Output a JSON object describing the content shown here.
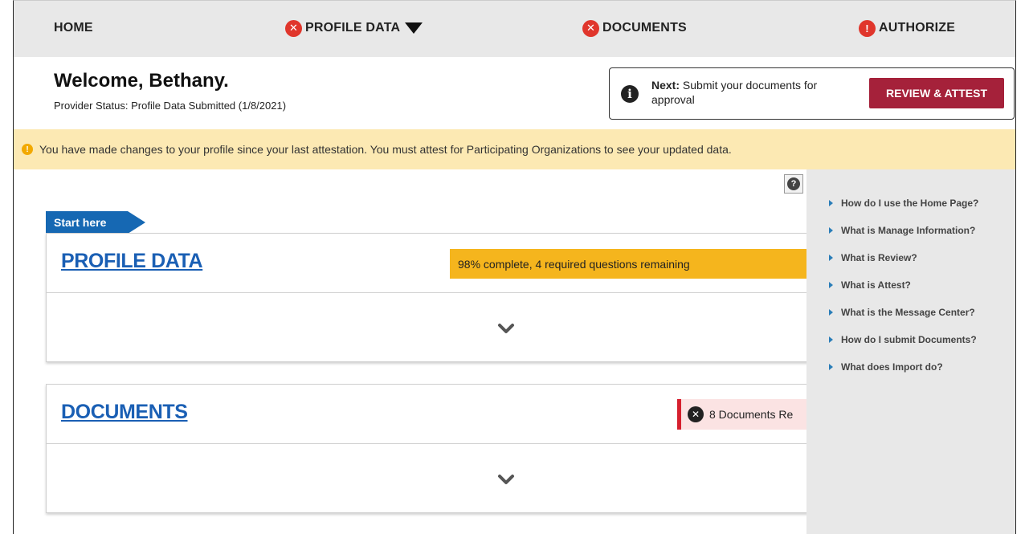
{
  "nav": {
    "home": "HOME",
    "profile_data": "PROFILE DATA",
    "documents": "DOCUMENTS",
    "authorize": "AUTHORIZE"
  },
  "header": {
    "welcome": "Welcome, Bethany.",
    "provider_status": "Provider Status:  Profile Data Submitted (1/8/2021)"
  },
  "next_step": {
    "label": "Next:",
    "text": "Submit your documents for approval",
    "button": "REVIEW & ATTEST"
  },
  "alert": {
    "message": "You have made changes to your profile since your last attestation. You must attest for Participating Organizations to see your updated data."
  },
  "start_tag": "Start here",
  "profile_card": {
    "title": "PROFILE DATA",
    "progress_text": "98% complete, 4 required questions remaining"
  },
  "documents_card": {
    "title": "DOCUMENTS",
    "badge_text": "8 Documents Re"
  },
  "help": {
    "items": [
      "How do I use the Home Page?",
      "What is Manage Information?",
      "What is Review?",
      "What is Attest?",
      "What is the Message Center?",
      "How do I submit Documents?",
      "What does Import do?"
    ]
  },
  "colors": {
    "nav_bg": "#e8e8e8",
    "error_red": "#e0362c",
    "primary_button": "#a5213a",
    "alert_bg": "#fce9b3",
    "progress_bg": "#f5b51d",
    "link_blue": "#1a5fb4",
    "start_tag_blue": "#1668b3",
    "doc_badge_bg": "#fbe3e3"
  }
}
